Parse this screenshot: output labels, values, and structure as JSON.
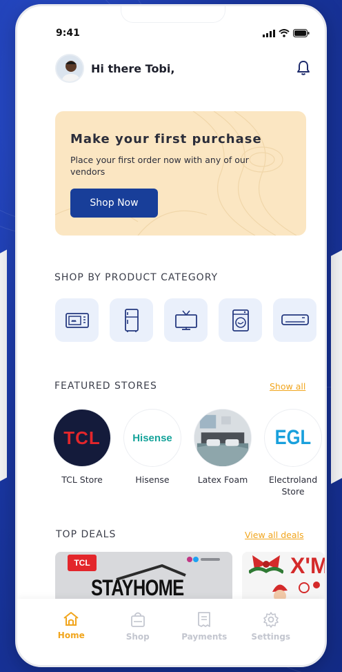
{
  "status": {
    "time": "9:41"
  },
  "header": {
    "greeting": "Hi there Tobi,"
  },
  "promo": {
    "title": "Make your first purchase",
    "text": "Place your first order now with any of our vendors",
    "button": "Shop Now"
  },
  "categories": {
    "title": "SHOP BY PRODUCT CATEGORY",
    "items": [
      "microwave-icon",
      "fridge-icon",
      "tv-icon",
      "washing-machine-icon",
      "air-conditioner-icon"
    ]
  },
  "stores": {
    "title": "FEATURED STORES",
    "show_all": "Show all",
    "items": [
      {
        "name": "TCL Store",
        "logo": "TCL"
      },
      {
        "name": "Hisense",
        "logo": "Hisense"
      },
      {
        "name": "Latex Foam",
        "logo": ""
      },
      {
        "name": "Electroland Store",
        "logo": "EGL"
      }
    ]
  },
  "deals": {
    "title": "TOP DEALS",
    "view_all": "View all deals",
    "items": [
      {
        "brand": "TCL",
        "headline": "STAYHOME"
      },
      {
        "headline": "X'M"
      }
    ]
  },
  "tabs": [
    {
      "label": "Home",
      "icon": "home-icon",
      "active": true
    },
    {
      "label": "Shop",
      "icon": "shopping-bag-icon",
      "active": false
    },
    {
      "label": "Payments",
      "icon": "receipt-icon",
      "active": false
    },
    {
      "label": "Settings",
      "icon": "gear-icon",
      "active": false
    }
  ],
  "colors": {
    "primary": "#183e99",
    "accent": "#f1a51c",
    "promo_bg": "#fbe6c2",
    "category_bg": "#eaf0fb"
  }
}
